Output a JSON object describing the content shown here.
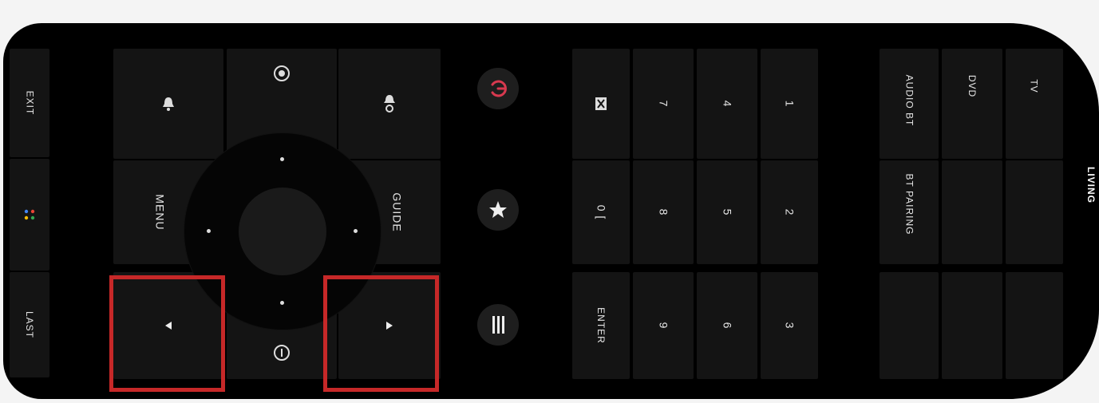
{
  "left_strip": {
    "top_label": "EXIT",
    "bottom_label": "LAST"
  },
  "nav": {
    "menu_label": "MENU",
    "guide_label": "GUIDE"
  },
  "power": {
    "color": "#d8394f"
  },
  "numpad": {
    "row_top": [
      "1",
      "4",
      "7"
    ],
    "row_mid": [
      "2",
      "5",
      "8",
      "0 ["
    ],
    "row_bottom": [
      "3",
      "6",
      "9"
    ],
    "enter_label": "ENTER"
  },
  "devices": {
    "tv": "TV",
    "dvd": "DVD",
    "audio_bt": "AUDIO BT",
    "bt_pairing": "BT PAIRING"
  },
  "room_label": "LIVING",
  "highlight_color": "#c62828",
  "icons": [
    "bell-icon",
    "settings-circle-icon",
    "bell-sound-icon",
    "power-icon",
    "star-icon",
    "menu-lines-icon",
    "mute-icon",
    "info-icon",
    "google-assistant-icon",
    "left-arrow-icon",
    "right-arrow-icon"
  ]
}
